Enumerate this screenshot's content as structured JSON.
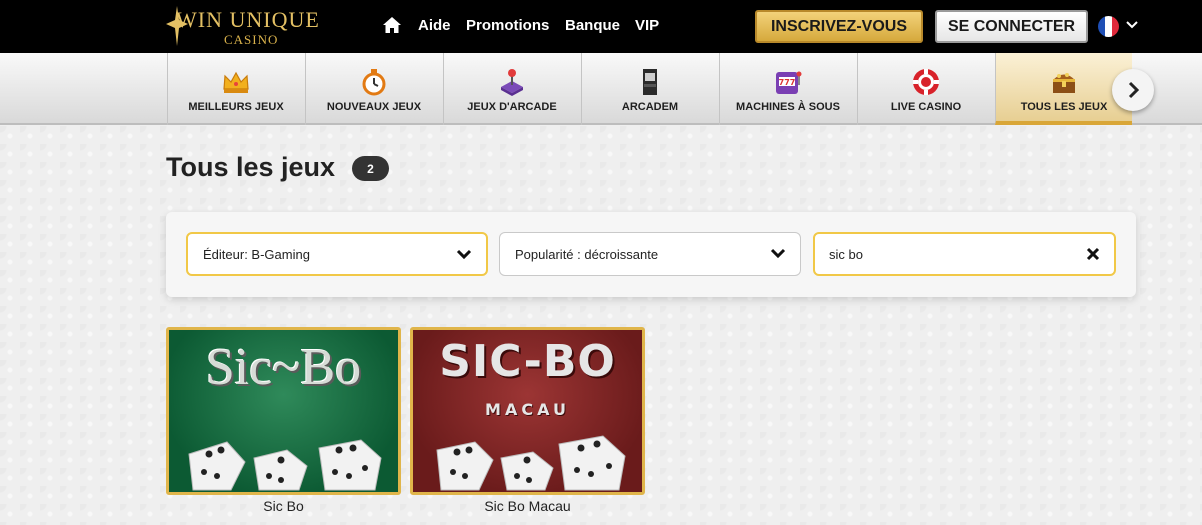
{
  "header": {
    "logo_main": "WIN UNIQUE",
    "logo_sub": "CASINO",
    "nav": [
      "Aide",
      "Promotions",
      "Banque",
      "VIP"
    ],
    "register_label": "INSCRIVEZ-VOUS",
    "login_label": "SE CONNECTER",
    "language": "fr"
  },
  "categories": [
    {
      "label": "MEILLEURS JEUX",
      "icon": "crown-icon"
    },
    {
      "label": "NOUVEAUX JEUX",
      "icon": "stopwatch-icon"
    },
    {
      "label": "JEUX D'ARCADE",
      "icon": "joystick-icon"
    },
    {
      "label": "ARCADEM",
      "icon": "arcade-cabinet-icon"
    },
    {
      "label": "MACHINES À SOUS",
      "icon": "slot-machine-icon"
    },
    {
      "label": "LIVE CASINO",
      "icon": "casino-chip-icon"
    },
    {
      "label": "TOUS LES JEUX",
      "icon": "treasure-chest-icon",
      "active": true
    }
  ],
  "page": {
    "title": "Tous les jeux",
    "count": "2"
  },
  "filters": {
    "provider": "Éditeur: B-Gaming",
    "sort": "Popularité : décroissante",
    "search_value": "sic bo"
  },
  "games": [
    {
      "name": "Sic Bo",
      "thumb_title": "Sic~Bo",
      "theme": "green"
    },
    {
      "name": "Sic Bo Macau",
      "thumb_title": "SIC-BO",
      "thumb_sub": "MACAU",
      "theme": "red"
    }
  ],
  "colors": {
    "accent_gold": "#e0b54a",
    "topbar": "#000000",
    "register_bg": "#e6bd55"
  }
}
